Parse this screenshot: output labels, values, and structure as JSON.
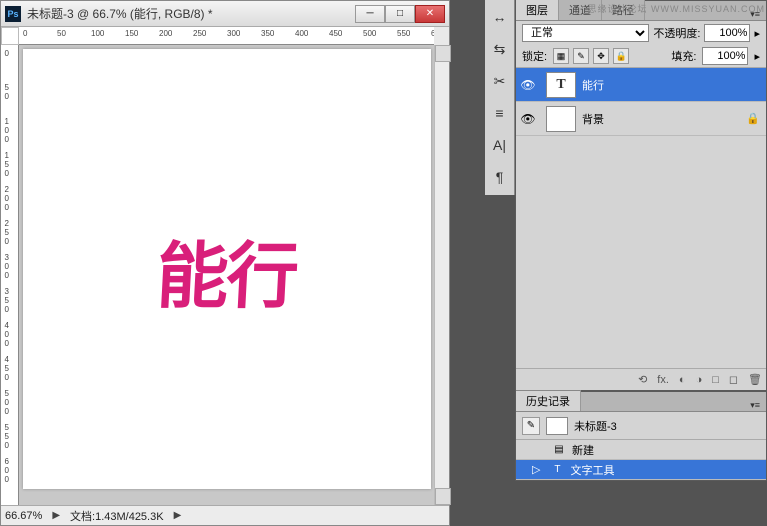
{
  "window": {
    "title": "未标题-3 @ 66.7% (能行, RGB/8) *",
    "ps_abbrev": "Ps",
    "min": "─",
    "max": "□",
    "close": "✕"
  },
  "ruler_h": [
    "0",
    "50",
    "100",
    "150",
    "200",
    "250",
    "300",
    "350",
    "400",
    "450",
    "500",
    "550",
    "6"
  ],
  "ruler_v": [
    "0",
    "50",
    "100",
    "150",
    "200",
    "250",
    "300",
    "350",
    "400",
    "450",
    "500",
    "550",
    "600"
  ],
  "canvas": {
    "text": "能行",
    "color": "#d91f7a"
  },
  "status": {
    "zoom": "66.67%",
    "docinfo": "文档:1.43M/425.3K",
    "arrow": "▶"
  },
  "panels": {
    "layers": {
      "tabs": [
        "图层",
        "通道",
        "路径"
      ],
      "blend_mode": "正常",
      "opacity_label": "不透明度:",
      "opacity": "100%",
      "lock_label": "锁定:",
      "fill_label": "填充:",
      "fill": "100%",
      "lock_icons": [
        "▦",
        "✎",
        "✥",
        "🔒"
      ],
      "items": [
        {
          "name": "能行",
          "thumb": "T",
          "visible": "👁",
          "selected": true,
          "locked": ""
        },
        {
          "name": "背景",
          "thumb": "",
          "visible": "👁",
          "selected": false,
          "locked": "🔒"
        }
      ],
      "foot": [
        "⟲",
        "fx.",
        "◐",
        "◑",
        "□",
        "◻",
        "🗑"
      ]
    },
    "history": {
      "tab": "历史记录",
      "doc_name": "未标题-3",
      "items": [
        {
          "icon": "▤",
          "label": "新建",
          "selected": false
        },
        {
          "icon": "T",
          "label": "文字工具",
          "selected": true
        }
      ]
    }
  },
  "watermark": "思缘设计论坛 WWW.MISSYUAN.COM",
  "side_icons": [
    "↔",
    "⇆",
    "✂",
    "≡",
    "A|",
    "¶"
  ]
}
